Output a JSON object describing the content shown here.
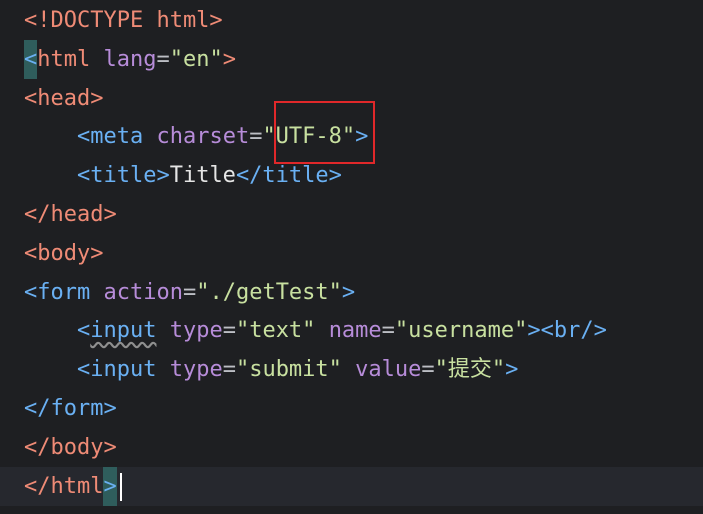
{
  "editor": {
    "lines": [
      {
        "parts": [
          {
            "t": "<!DOCTYPE html>",
            "c": "doctype"
          }
        ]
      },
      {
        "parts": [
          {
            "t": "<",
            "c": "br caret-block"
          },
          {
            "t": "html",
            "c": "tagname"
          },
          {
            "t": " ",
            "c": "text"
          },
          {
            "t": "lang",
            "c": "attr"
          },
          {
            "t": "=",
            "c": "eq"
          },
          {
            "t": "\"en\"",
            "c": "str"
          },
          {
            "t": ">",
            "c": "br"
          }
        ]
      },
      {
        "parts": [
          {
            "t": "<head>",
            "c": "tagname"
          }
        ]
      },
      {
        "parts": [
          {
            "t": "    ",
            "c": "text"
          },
          {
            "t": "<meta",
            "c": "tagname blue"
          },
          {
            "t": " ",
            "c": "text"
          },
          {
            "t": "charset",
            "c": "attr"
          },
          {
            "t": "=",
            "c": "eq"
          },
          {
            "t": "\"UTF-8\"",
            "c": "str"
          },
          {
            "t": ">",
            "c": "br blue"
          }
        ]
      },
      {
        "parts": [
          {
            "t": "    ",
            "c": "text"
          },
          {
            "t": "<title>",
            "c": "tagname blue"
          },
          {
            "t": "Title",
            "c": "str plain"
          },
          {
            "t": "</title>",
            "c": "tagname blue"
          }
        ]
      },
      {
        "parts": [
          {
            "t": "</head>",
            "c": "tagname"
          }
        ]
      },
      {
        "parts": [
          {
            "t": "<body>",
            "c": "tagname"
          }
        ]
      },
      {
        "parts": [
          {
            "t": "<form",
            "c": "tagname blue"
          },
          {
            "t": " ",
            "c": "text"
          },
          {
            "t": "action",
            "c": "attr"
          },
          {
            "t": "=",
            "c": "eq"
          },
          {
            "t": "\"./getTest\"",
            "c": "str"
          },
          {
            "t": ">",
            "c": "br blue"
          }
        ]
      },
      {
        "parts": [
          {
            "t": "    ",
            "c": "text"
          },
          {
            "t": "<",
            "c": "tagname blue"
          },
          {
            "t": "input",
            "c": "tagname blue squiggle"
          },
          {
            "t": " ",
            "c": "text"
          },
          {
            "t": "type",
            "c": "attr"
          },
          {
            "t": "=",
            "c": "eq"
          },
          {
            "t": "\"text\"",
            "c": "str"
          },
          {
            "t": " ",
            "c": "text"
          },
          {
            "t": "name",
            "c": "attr"
          },
          {
            "t": "=",
            "c": "eq"
          },
          {
            "t": "\"username\"",
            "c": "str"
          },
          {
            "t": "><br/>",
            "c": "tagname blue"
          }
        ]
      },
      {
        "parts": [
          {
            "t": "    ",
            "c": "text"
          },
          {
            "t": "<input",
            "c": "tagname blue"
          },
          {
            "t": " ",
            "c": "text"
          },
          {
            "t": "type",
            "c": "attr"
          },
          {
            "t": "=",
            "c": "eq"
          },
          {
            "t": "\"submit\"",
            "c": "str"
          },
          {
            "t": " ",
            "c": "text"
          },
          {
            "t": "value",
            "c": "attr"
          },
          {
            "t": "=",
            "c": "eq"
          },
          {
            "t": "\"提交\"",
            "c": "str"
          },
          {
            "t": ">",
            "c": "br blue"
          }
        ]
      },
      {
        "parts": [
          {
            "t": "</form>",
            "c": "tagname blue"
          }
        ]
      },
      {
        "parts": [
          {
            "t": "</body>",
            "c": "tagname"
          }
        ]
      },
      {
        "parts": [
          {
            "t": "</html",
            "c": "tagname"
          },
          {
            "t": ">",
            "c": "br caret-block"
          }
        ]
      }
    ],
    "current_line": 12,
    "highlight_target": "\"UTF-8\""
  }
}
